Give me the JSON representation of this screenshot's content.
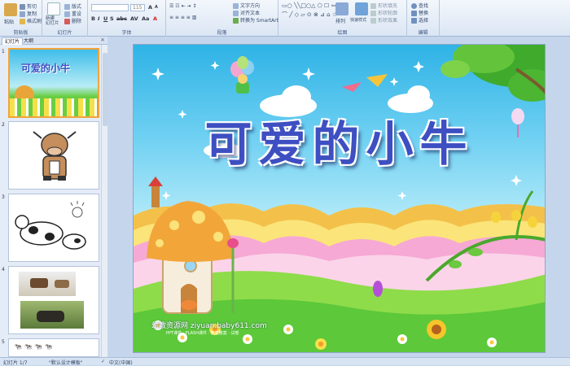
{
  "ribbon": {
    "groups": [
      {
        "label": "剪贴板"
      },
      {
        "label": "幻灯片"
      },
      {
        "label": "字体"
      },
      {
        "label": "段落"
      },
      {
        "label": "绘图"
      },
      {
        "label": "编辑"
      }
    ],
    "clipboard": {
      "paste": "粘贴",
      "cut": "剪切",
      "copy": "复制",
      "format_painter": "格式刷"
    },
    "slides": {
      "new_slide": "新建\n幻灯片",
      "layout": "版式",
      "reset": "重设",
      "delete": "删除"
    },
    "font": {
      "font_name": "",
      "font_size": "115"
    },
    "paragraph": {
      "text_direction": "文字方向",
      "align_text": "对齐文本",
      "smartart": "转换为 SmartArt"
    },
    "drawing": {
      "arrange": "排列",
      "quick_styles": "快速样式",
      "shape_fill": "形状填充",
      "shape_outline": "形状轮廓",
      "shape_effects": "形状效果"
    },
    "editing": {
      "find": "查找",
      "replace": "替换",
      "select": "选择"
    }
  },
  "left_pane": {
    "tabs": [
      "幻灯片",
      "大纲"
    ],
    "close": "×",
    "thumb1_title": "可爱的小牛",
    "slide_numbers": [
      "1",
      "2",
      "3",
      "4",
      "5"
    ]
  },
  "slide": {
    "title": "可爱的小牛",
    "credit": "幼教资源网 ziyuan.baby611.com",
    "credit_small": "PPT课件 · FLASH课件 · 教案教案 · 试卷"
  },
  "status": {
    "slide_count": "幻灯片 1/7",
    "theme": "\"默认设计模板\"",
    "language": "中文(中国)"
  },
  "colors": {
    "title": "#3e4fc2",
    "sky_top": "#2eb3e6",
    "grass": "#5cc83a",
    "ribbon_bg": "#dbe6f4"
  }
}
